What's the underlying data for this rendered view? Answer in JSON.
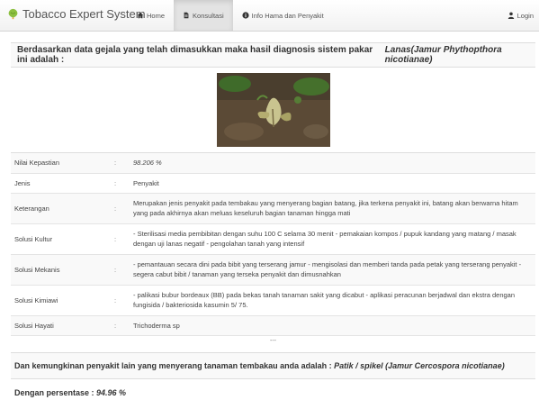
{
  "navbar": {
    "brand": "Tobacco Expert System",
    "items": [
      {
        "label": "Home",
        "icon": "home-icon"
      },
      {
        "label": "Konsultasi",
        "icon": "document-icon"
      },
      {
        "label": "Info Hama dan Penyakit",
        "icon": "info-icon"
      }
    ],
    "login": "Login"
  },
  "result": {
    "prefix": "Berdasarkan data gejala yang telah dimasukkan maka hasil diagnosis sistem pakar ini adalah : ",
    "disease": "Lanas(Jamur Phythopthora nicotianae)"
  },
  "rows": [
    {
      "label": "Nilai Kepastian",
      "sep": ":",
      "value": "98.206 %"
    },
    {
      "label": "Jenis",
      "sep": ":",
      "value": "Penyakit"
    },
    {
      "label": "Keterangan",
      "sep": ":",
      "value": "Merupakan jenis penyakit pada tembakau yang menyerang bagian batang, jika terkena penyakit ini, batang akan berwarna hitam yang pada akhirnya akan meluas keseluruh bagian tanaman hingga mati"
    },
    {
      "label": "Solusi Kultur",
      "sep": ":",
      "value": "- Sterilisasi media pembibitan dengan suhu 100 C selama 30 menit - pemakaian kompos / pupuk kandang yang matang / masak dengan uji lanas negatif - pengolahan tanah yang intensif"
    },
    {
      "label": "Solusi Mekanis",
      "sep": ":",
      "value": "- pemantauan secara dini pada bibit yang terserang jamur - mengisolasi dan memberi tanda pada petak yang terserang penyakit - segera cabut bibit / tanaman yang terseka penyakit dan dimusnahkan"
    },
    {
      "label": "Solusi Kimiawi",
      "sep": ":",
      "value": "- palikasi bubur bordeaux (BB) pada bekas tanah tanaman sakit yang dicabut - aplikasi peracunan berjadwal dan ekstra dengan fungisida / bakteriosida kasumin 5/ 75."
    },
    {
      "label": "Solusi Hayati",
      "sep": ":",
      "value": "Trichoderma sp"
    }
  ],
  "divider": "---",
  "alternative": {
    "prefix": "Dan kemungkinan penyakit lain yang menyerang tanaman tembakau anda adalah : ",
    "disease": "Patik / spikel (Jamur Cercospora nicotianae)"
  },
  "percentage": {
    "label": "Dengan persentase : ",
    "value": "94.96 %"
  }
}
